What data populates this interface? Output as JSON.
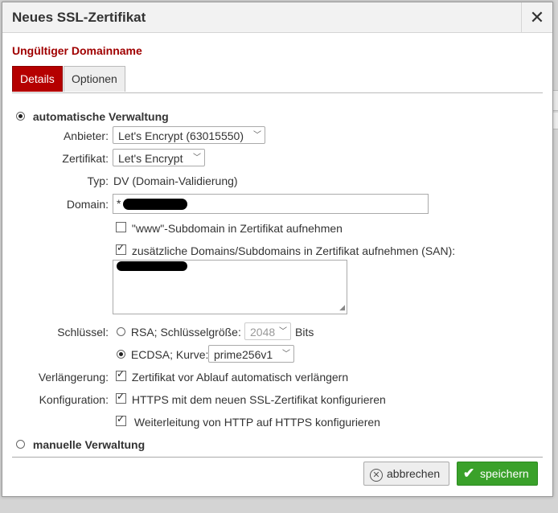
{
  "dialog": {
    "title": "Neues SSL-Zertifikat",
    "close_label": "✕",
    "error": "Ungültiger Domainname"
  },
  "tabs": [
    {
      "label": "Details",
      "active": true
    },
    {
      "label": "Optionen",
      "active": false
    }
  ],
  "auto": {
    "label": "automatische Verwaltung",
    "selected": true
  },
  "fields": {
    "anbieter_label": "Anbieter:",
    "anbieter_value": "Let's Encrypt (63015550)",
    "zertifikat_label": "Zertifikat:",
    "zertifikat_value": "Let's Encrypt",
    "typ_label": "Typ:",
    "typ_value": "DV (Domain-Validierung)",
    "domain_label": "Domain:",
    "domain_value": "*",
    "www_label": "\"www\"-Subdomain in Zertifikat aufnehmen",
    "www_checked": false,
    "san_label": "zusätzliche Domains/Subdomains in Zertifikat aufnehmen (SAN):",
    "san_checked": true,
    "schluessel_label": "Schlüssel:",
    "rsa_label": "RSA; Schlüsselgröße:",
    "rsa_size": "2048",
    "bits_label": "Bits",
    "ecdsa_label": "ECDSA; Kurve:",
    "ecdsa_curve": "prime256v1",
    "verlaengerung_label": "Verlängerung:",
    "verlaengerung_text": "Zertifikat vor Ablauf automatisch verlängern",
    "konfig_label": "Konfiguration:",
    "https_text": "HTTPS mit dem neuen SSL-Zertifikat konfigurieren",
    "redirect_text": "Weiterleitung von HTTP auf HTTPS konfigurieren"
  },
  "manual": {
    "label": "manuelle Verwaltung",
    "selected": false
  },
  "buttons": {
    "cancel_label": "abbrechen",
    "save_label": "speichern"
  },
  "colors": {
    "accent": "#b50000",
    "error": "#a00000",
    "save": "#3aa12a"
  }
}
